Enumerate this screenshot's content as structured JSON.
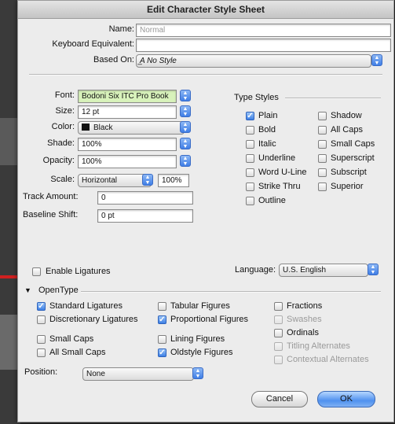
{
  "window": {
    "title": "Edit Character Style Sheet"
  },
  "top": {
    "name_label": "Name:",
    "name_value": "Normal",
    "keyboard_label": "Keyboard Equivalent:",
    "keyboard_value": "",
    "based_on_label": "Based On:",
    "based_on_value": "̲A No Style"
  },
  "font": {
    "font_label": "Font:",
    "font_value": "Bodoni Six ITC Pro Book",
    "size_label": "Size:",
    "size_value": "12 pt",
    "color_label": "Color:",
    "color_value": "Black",
    "shade_label": "Shade:",
    "shade_value": "100%",
    "opacity_label": "Opacity:",
    "opacity_value": "100%",
    "scale_label": "Scale:",
    "scale_mode": "Horizontal",
    "scale_value": "100%",
    "track_label": "Track Amount:",
    "track_value": "0",
    "baseline_label": "Baseline Shift:",
    "baseline_value": "0 pt"
  },
  "type_styles": {
    "heading": "Type Styles",
    "left": [
      {
        "label": "Plain",
        "checked": true
      },
      {
        "label": "Bold",
        "checked": false
      },
      {
        "label": "Italic",
        "checked": false
      },
      {
        "label": "Underline",
        "checked": false
      },
      {
        "label": "Word U-Line",
        "checked": false
      },
      {
        "label": "Strike Thru",
        "checked": false
      },
      {
        "label": "Outline",
        "checked": false
      }
    ],
    "right": [
      {
        "label": "Shadow",
        "checked": false
      },
      {
        "label": "All Caps",
        "checked": false
      },
      {
        "label": "Small Caps",
        "checked": false
      },
      {
        "label": "Superscript",
        "checked": false
      },
      {
        "label": "Subscript",
        "checked": false
      },
      {
        "label": "Superior",
        "checked": false
      }
    ]
  },
  "ligatures": {
    "label": "Enable Ligatures",
    "checked": false
  },
  "language": {
    "label": "Language:",
    "value": "U.S. English"
  },
  "opentype": {
    "heading": "OpenType",
    "col1": [
      {
        "label": "Standard Ligatures",
        "checked": true
      },
      {
        "label": "Discretionary Ligatures",
        "checked": false
      },
      {
        "label": "Small Caps",
        "checked": false
      },
      {
        "label": "All Small Caps",
        "checked": false
      }
    ],
    "col2": [
      {
        "label": "Tabular Figures",
        "checked": false
      },
      {
        "label": "Proportional Figures",
        "checked": true
      },
      {
        "label": "Lining Figures",
        "checked": false
      },
      {
        "label": "Oldstyle Figures",
        "checked": true
      }
    ],
    "col3": [
      {
        "label": "Fractions",
        "checked": false,
        "enabled": true
      },
      {
        "label": "Swashes",
        "checked": false,
        "enabled": false
      },
      {
        "label": "Ordinals",
        "checked": false,
        "enabled": true
      },
      {
        "label": "Titling Alternates",
        "checked": false,
        "enabled": false
      },
      {
        "label": "Contextual Alternates",
        "checked": false,
        "enabled": false
      }
    ],
    "position_label": "Position:",
    "position_value": "None"
  },
  "buttons": {
    "cancel": "Cancel",
    "ok": "OK"
  },
  "colors": {
    "accent": "#3f7ee6",
    "font_field_bg": "#d8f2bb",
    "window_bg": "#ececec"
  }
}
